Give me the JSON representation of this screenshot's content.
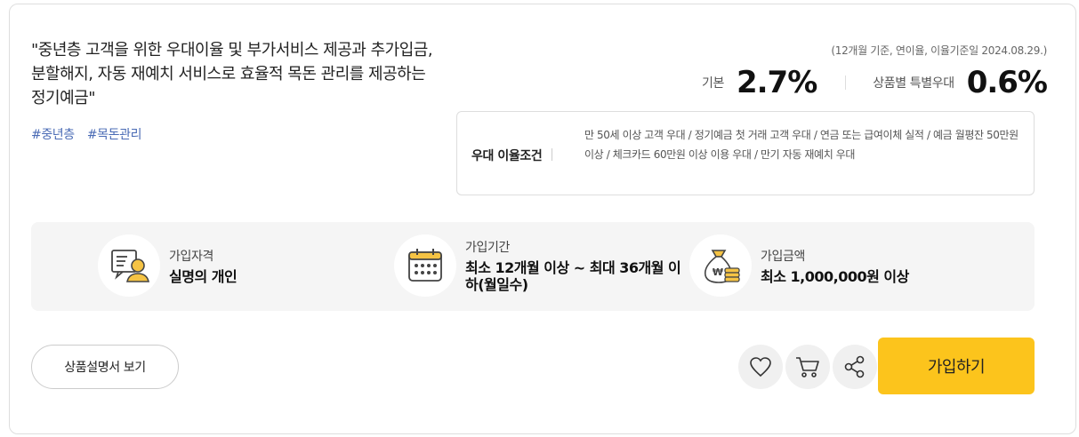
{
  "product": {
    "description": "\"중년층 고객을 위한 우대이율 및 부가서비스 제공과 추가입금, 분할해지, 자동 재예치 서비스로 효율적 목돈 관리를 제공하는 정기예금\"",
    "tags": [
      "#중년층",
      "#목돈관리"
    ]
  },
  "rates": {
    "basis_note": "(12개월 기준, 연이율, 이율기준일 2024.08.29.)",
    "base_label": "기본",
    "base_value": "2.7%",
    "special_label": "상품별 특별우대",
    "special_value": "0.6%"
  },
  "conditions": {
    "title": "우대 이율조건",
    "text": "만 50세 이상 고객 우대  /  정기예금 첫 거래 고객 우대  /  연금 또는 급여이체 실적  /  예금 월평잔 50만원 이상  /  체크카드 60만원 이상 이용 우대  /  만기 자동 재예치 우대"
  },
  "info": [
    {
      "icon": "person-document-icon",
      "label": "가입자격",
      "value": "실명의 개인"
    },
    {
      "icon": "calendar-icon",
      "label": "가입기간",
      "value": "최소 12개월 이상 ~ 최대 36개월 이하(월일수)"
    },
    {
      "icon": "money-bag-icon",
      "label": "가입금액",
      "value": "최소 1,000,000원 이상"
    }
  ],
  "actions": {
    "doc_label": "상품설명서 보기",
    "join_label": "가입하기"
  },
  "colors": {
    "accent": "#fcc41c",
    "tag": "#4a6bb5",
    "icon_outline": "#444444",
    "icon_fill": "#f5c344"
  }
}
